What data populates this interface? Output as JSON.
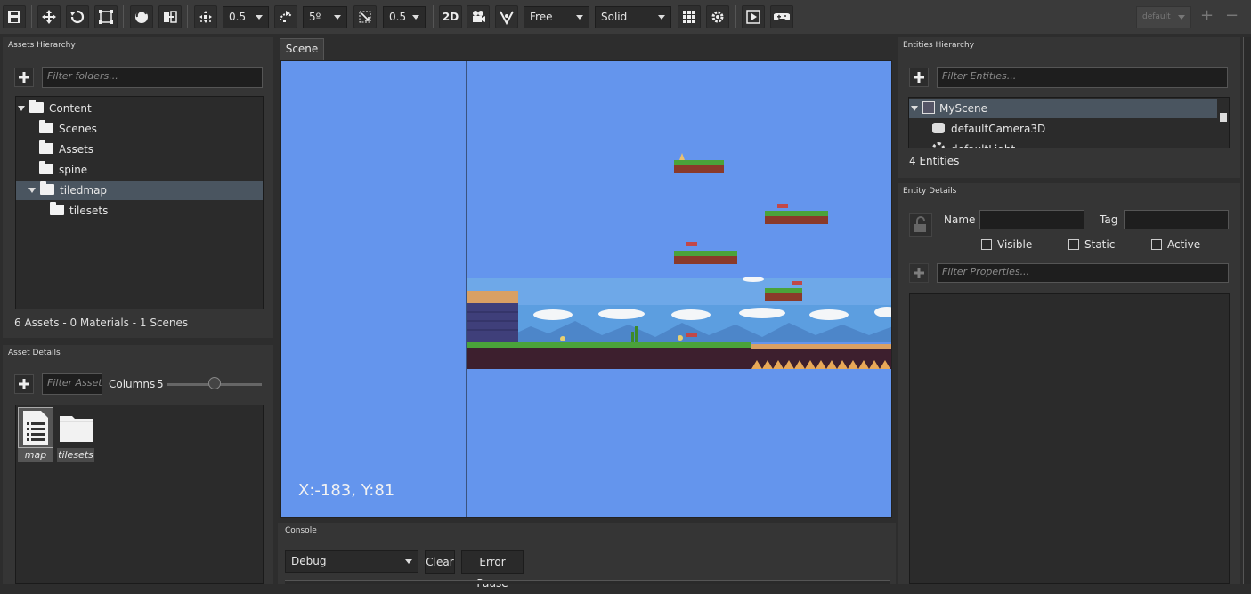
{
  "toolbar": {
    "translate_snap": "0.5",
    "rotate_snap": "5º",
    "scale_snap": "0.5",
    "mode_2d": "2D",
    "camera_mode": "Free",
    "render_mode": "Solid",
    "profile": "default",
    "add": "+",
    "remove": "−"
  },
  "assets_hierarchy": {
    "title": "Assets Hierarchy",
    "filter_placeholder": "Filter folders...",
    "tree": [
      {
        "label": "Content"
      },
      {
        "label": "Scenes"
      },
      {
        "label": "Assets"
      },
      {
        "label": "spine"
      },
      {
        "label": "tiledmap"
      },
      {
        "label": "tilesets"
      }
    ],
    "summary": "6 Assets - 0 Materials - 1 Scenes"
  },
  "asset_details": {
    "title": "Asset Details",
    "filter_placeholder": "Filter Assets",
    "columns_label": "Columns",
    "columns_value": "5",
    "columns_fraction": 0.5,
    "items": [
      {
        "label": "map",
        "icon": "document-icon"
      },
      {
        "label": "tilesets",
        "icon": "folder-icon"
      }
    ]
  },
  "scene": {
    "tab": "Scene",
    "coords": "X:-183, Y:81",
    "sky_color": "#6495ed"
  },
  "console": {
    "title": "Console",
    "level": "Debug",
    "clear": "Clear",
    "error_pause": "Error Pause"
  },
  "entities_hierarchy": {
    "title": "Entities Hierarchy",
    "filter_placeholder": "Filter Entities...",
    "items": [
      {
        "label": "MyScene"
      },
      {
        "label": "defaultCamera3D"
      },
      {
        "label": "defaultLight"
      }
    ],
    "count": "4 Entities"
  },
  "entity_details": {
    "title": "Entity Details",
    "name_label": "Name",
    "tag_label": "Tag",
    "visible_label": "Visible",
    "static_label": "Static",
    "active_label": "Active",
    "filter_placeholder": "Filter Properties..."
  }
}
